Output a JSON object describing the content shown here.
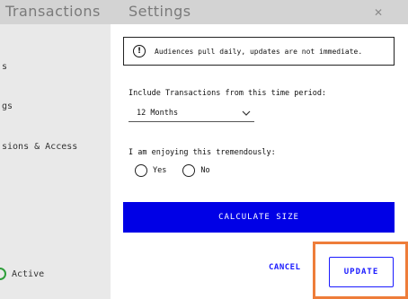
{
  "background": {
    "title": "Transactions",
    "sidebar": [
      {
        "label": "s"
      },
      {
        "label": "gs"
      },
      {
        "label": "sions & Access"
      }
    ],
    "status": "Active"
  },
  "dialog": {
    "title": "Settings",
    "close_icon": "close-icon",
    "notice": "Audiences pull daily, updates are not immediate.",
    "period": {
      "label": "Include Transactions from this time period:",
      "selected": "12 Months"
    },
    "enjoy": {
      "label": "I am enjoying this tremendously:",
      "options": [
        "Yes",
        "No"
      ]
    },
    "calculate_label": "CALCULATE SIZE",
    "cancel_label": "CANCEL",
    "update_label": "UPDATE"
  },
  "colors": {
    "accent": "#0000e6",
    "link": "#1a1aff",
    "highlight": "#ee7d3a",
    "status_green": "#2e9e3a"
  }
}
